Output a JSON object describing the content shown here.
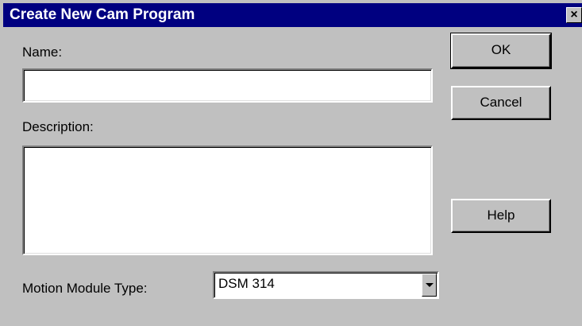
{
  "window": {
    "title": "Create New Cam Program",
    "close_glyph": "×"
  },
  "form": {
    "name_label": "Name:",
    "name_value": "",
    "description_label": "Description:",
    "description_value": "",
    "motion_module_label": "Motion Module Type:",
    "motion_module_value": "DSM 314"
  },
  "buttons": {
    "ok_label": "OK",
    "cancel_label": "Cancel",
    "help_label": "Help"
  },
  "icons": {
    "close": "close-icon",
    "dropdown": "chevron-down-icon"
  },
  "colors": {
    "titlebar": "#000080",
    "face": "#c0c0c0",
    "field": "#ffffff"
  }
}
